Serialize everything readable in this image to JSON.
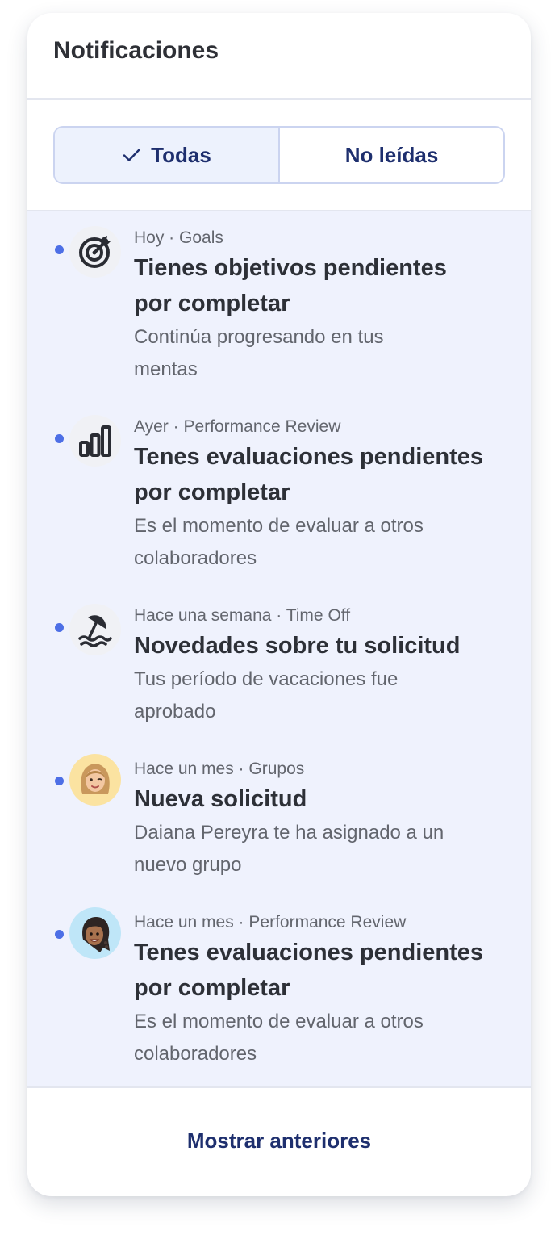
{
  "header": {
    "title": "Notificaciones"
  },
  "filters": {
    "all_label": "Todas",
    "unread_label": "No leídas",
    "active": "all"
  },
  "colors": {
    "accent": "#1e2f6e",
    "unread_dot": "#4d6fe6",
    "list_background": "#eff2fd"
  },
  "notifications": [
    {
      "meta": "Hoy · Goals",
      "title_line1": "Tienes objetivos pendientes",
      "title_line2": "por completar",
      "desc_line1": "Continúa progresando en tus",
      "desc_line2": "mentas",
      "icon": "target-icon",
      "unread": true
    },
    {
      "meta": "Ayer · Performance Review",
      "title_line1": "Tenes evaluaciones pendientes",
      "title_line2": "por completar",
      "desc_line1": "Es el momento de evaluar a otros",
      "desc_line2": "colaboradores",
      "icon": "bar-chart-icon",
      "unread": true
    },
    {
      "meta": "Hace una semana · Time Off",
      "title_line1": "Novedades sobre tu solicitud",
      "desc_line1": "Tus período de vacaciones fue",
      "desc_line2": "aprobado",
      "icon": "beach-umbrella-icon",
      "unread": true
    },
    {
      "meta": "Hace un mes · Grupos",
      "title_line1": "Nueva solicitud",
      "desc_line1": "Daiana Pereyra te ha asignado a un",
      "desc_line2": "nuevo grupo",
      "icon": "avatar-blonde-woman-icon",
      "unread": true
    },
    {
      "meta": "Hace un mes · Performance Review",
      "title_line1": "Tenes evaluaciones pendientes",
      "title_line2": "por completar",
      "desc_line1": "Es el momento de evaluar a otros",
      "desc_line2": "colaboradores",
      "icon": "avatar-braids-woman-icon",
      "unread": true
    }
  ],
  "footer": {
    "show_older_label": "Mostrar anteriores"
  }
}
